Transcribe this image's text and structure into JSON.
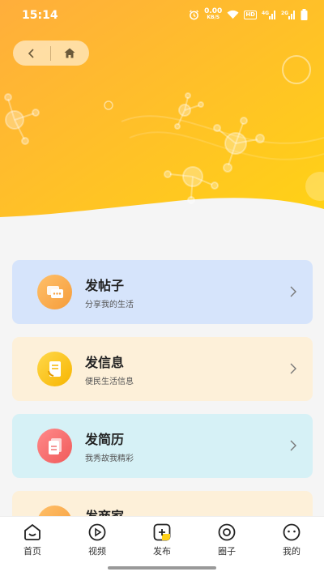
{
  "status_bar": {
    "time": "15:14",
    "net_speed_value": "0.00",
    "net_speed_unit": "KB/S",
    "hd_label": "HD",
    "signal_1_label": "4G",
    "signal_2_label": "2G"
  },
  "colors": {
    "header_gradient_start": "#ffb53a",
    "header_gradient_end": "#ffd11a",
    "card_post_bg": "#d6e4fb",
    "card_info_bg": "#fdf0d9",
    "card_resume_bg": "#d6f1f6",
    "card_merchant_bg": "#fdf0d9"
  },
  "cards": [
    {
      "title": "发帖子",
      "subtitle": "分享我的生活",
      "icon": "chat-bubbles-icon"
    },
    {
      "title": "发信息",
      "subtitle": "便民生活信息",
      "icon": "phone-doc-icon"
    },
    {
      "title": "发简历",
      "subtitle": "我秀故我精彩",
      "icon": "resume-doc-icon"
    },
    {
      "title": "发商家",
      "subtitle": "",
      "icon": "shop-icon"
    }
  ],
  "tabs": [
    {
      "label": "首页",
      "icon": "home-icon"
    },
    {
      "label": "视频",
      "icon": "video-play-icon"
    },
    {
      "label": "发布",
      "icon": "publish-plus-icon",
      "active": true
    },
    {
      "label": "圈子",
      "icon": "circle-icon"
    },
    {
      "label": "我的",
      "icon": "profile-face-icon"
    }
  ]
}
